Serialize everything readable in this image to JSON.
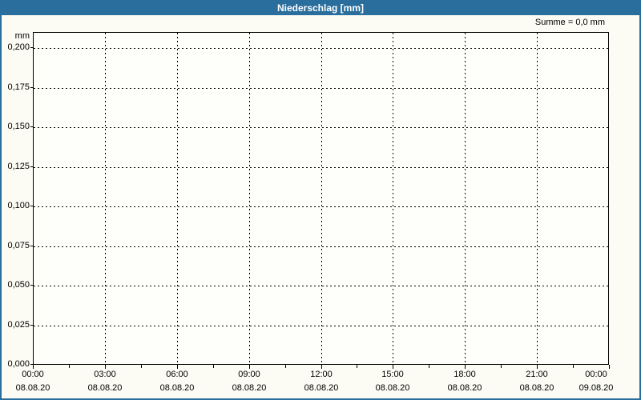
{
  "colors": {
    "titlebar": "#2A6E9D",
    "frame_border": "#2A6E9D",
    "title_text": "#FFFFFF",
    "background": "#FCFCF4",
    "plot_background": "#FEFEFA",
    "grid": "#000000",
    "axis_text": "#000000"
  },
  "chart_data": {
    "type": "bar",
    "title": "Niederschlag [mm]",
    "xlabel": "",
    "ylabel": "mm",
    "summary_annotation": "Summe = 0,0 mm",
    "ylim": [
      0,
      0.2
    ],
    "y_tick_values": [
      0,
      0.025,
      0.05,
      0.075,
      0.1,
      0.125,
      0.15,
      0.175,
      0.2
    ],
    "y_tick_labels": [
      "0,000",
      "0,025",
      "0,050",
      "0,075",
      "0,100",
      "0,125",
      "0,150",
      "0,175",
      "0,200"
    ],
    "x_ticks": [
      {
        "time": "00:00",
        "date": "08.08.20"
      },
      {
        "time": "03:00",
        "date": "08.08.20"
      },
      {
        "time": "06:00",
        "date": "08.08.20"
      },
      {
        "time": "09:00",
        "date": "08.08.20"
      },
      {
        "time": "12:00",
        "date": "08.08.20"
      },
      {
        "time": "15:00",
        "date": "08.08.20"
      },
      {
        "time": "18:00",
        "date": "08.08.20"
      },
      {
        "time": "21:00",
        "date": "08.08.20"
      },
      {
        "time": "00:00",
        "date": "09.08.20"
      }
    ],
    "series": [
      {
        "name": "Niederschlag",
        "values": []
      }
    ],
    "grid": "dashed",
    "legend": "none"
  }
}
